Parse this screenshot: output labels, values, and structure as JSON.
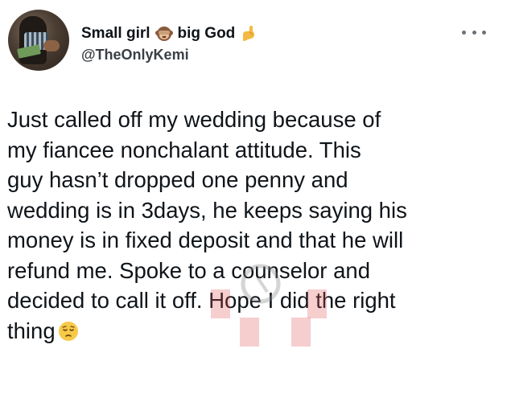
{
  "tweet": {
    "display_name_part1": "Small girl",
    "display_name_part2": "big God",
    "handle": "@TheOnlyKemi",
    "body": "Just called off my wedding because of\nmy fiancee nonchalant attitude. This\nguy hasn’t dropped one penny and\nwedding is in 3days, he keeps saying his\nmoney is in fixed deposit and that he will\nrefund me. Spoke to a counselor and\ndecided to call it off. Hope I did the right\nthing",
    "icons": {
      "name_emoji_1": "see-no-evil-monkey-icon",
      "name_emoji_2": "flexed-biceps-icon",
      "end_emoji": "pensive-face-icon",
      "menu": "more-options-icon"
    }
  }
}
